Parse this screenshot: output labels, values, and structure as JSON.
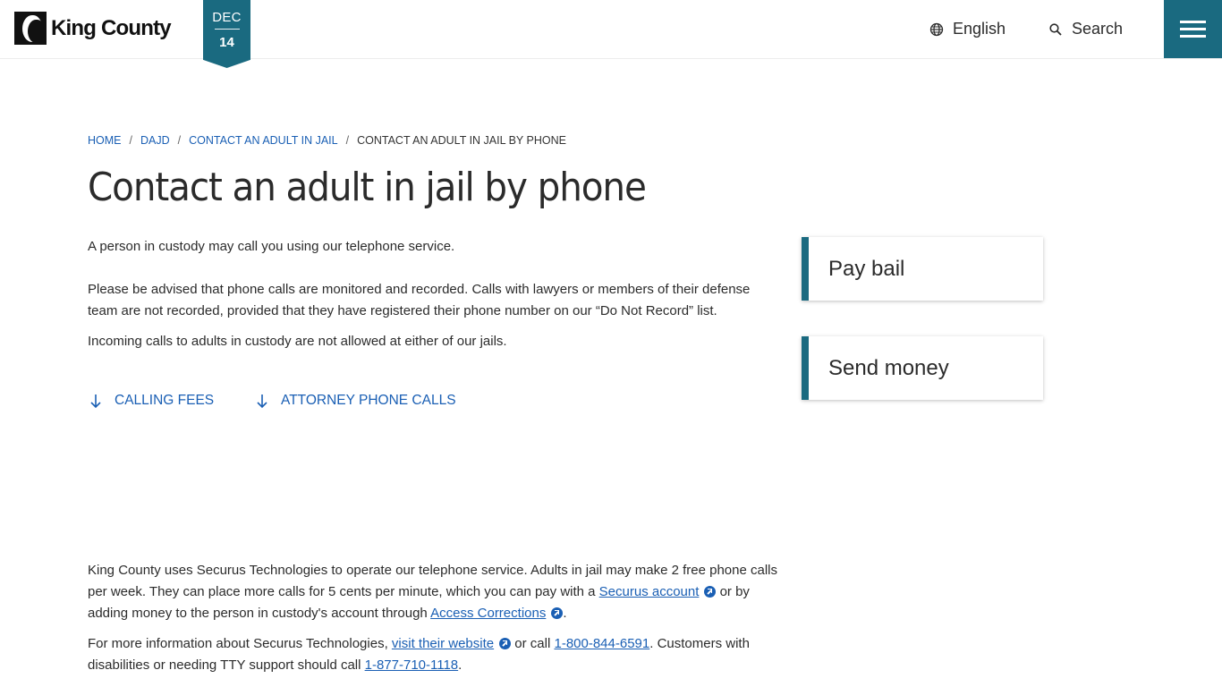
{
  "header": {
    "logo_text": "King County",
    "date": {
      "month": "DEC",
      "day": "14"
    },
    "language_label": "English",
    "search_label": "Search"
  },
  "breadcrumb": {
    "items": [
      "HOME",
      "DAJD",
      "CONTACT AN ADULT IN JAIL"
    ],
    "current": "CONTACT AN ADULT IN JAIL BY PHONE",
    "separator": "/"
  },
  "page": {
    "title": "Contact an adult in jail by phone",
    "intro": "A person in custody may call you using our telephone service.",
    "monitoring": "Please be advised that phone calls are monitored and recorded. Calls with lawyers or members of their defense team are not recorded, provided that they have registered their phone number on our “Do Not Record” list.",
    "incoming": "Incoming calls to adults in custody are not allowed at either of our jails."
  },
  "jump_links": [
    "CALLING FEES",
    "ATTORNEY PHONE CALLS"
  ],
  "fees": {
    "text_1": "King County uses Securus Technologies to operate our telephone service. Adults in jail may make 2 free phone calls per week. They can place more calls for 5 cents per minute, which you can pay with a ",
    "link_securus_account": "Securus account",
    "text_2": " or by adding money to the person in custody's account through ",
    "link_access_corrections": "Access Corrections",
    "text_3": "."
  },
  "more_info": {
    "text_1": "For more information about Securus Technologies, ",
    "link_website": "visit their website",
    "text_2": " or call ",
    "phone_1": "1-800-844-6591",
    "text_3": ". Customers with disabilities or needing TTY support should call ",
    "phone_2": "1-877-710-1118",
    "text_4": "."
  },
  "side_cards": [
    "Pay bail",
    "Send money"
  ],
  "colors": {
    "brand_teal": "#1a6a80",
    "link_blue": "#1a5fb4",
    "text": "#2b2b2b"
  }
}
